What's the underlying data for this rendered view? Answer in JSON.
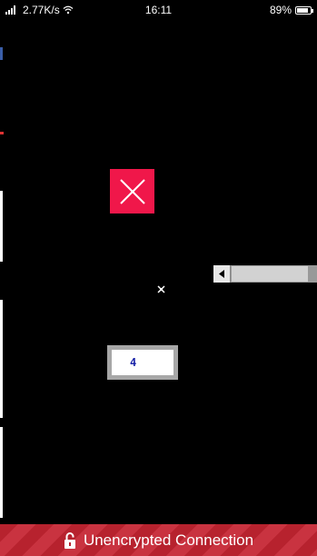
{
  "status_bar": {
    "network_speed": "2.77K/s",
    "time": "16:11",
    "battery_percent": "89%",
    "battery_level": 0.89,
    "signal_icon": "signal-icon",
    "wifi_icon": "wifi-icon",
    "battery_icon": "battery-icon"
  },
  "overlay": {
    "close_icon": "close-icon",
    "close_color": "#f0174a",
    "value_field": {
      "value": "4"
    },
    "scrollbar": {
      "arrow_icon": "arrow-left-icon"
    }
  },
  "banner": {
    "text": "Unencrypted Connection",
    "icon": "unlocked-lock-icon",
    "color": "#b7222e"
  }
}
